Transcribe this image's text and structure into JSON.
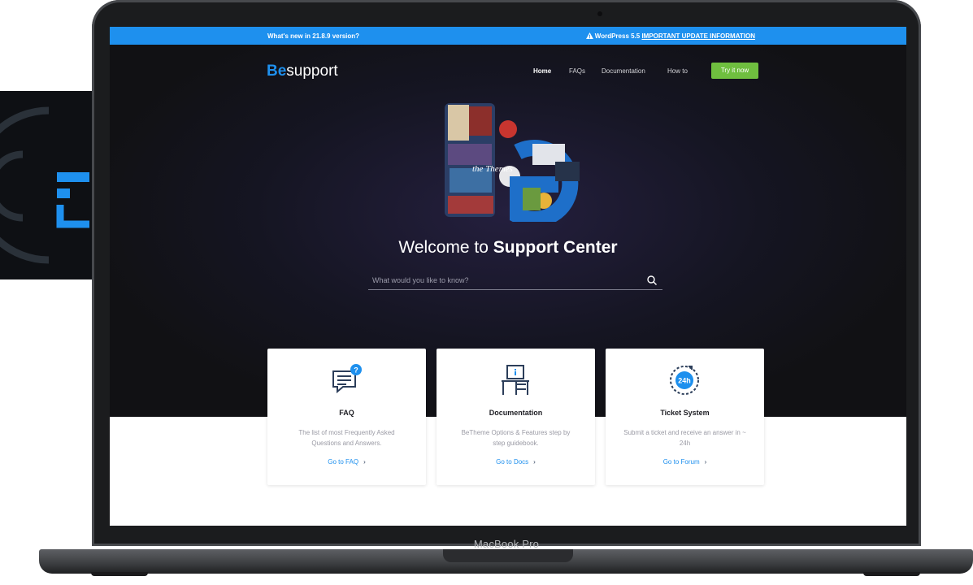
{
  "device": {
    "label": "MacBook Pro"
  },
  "announcement": {
    "left_prefix": "What's new in ",
    "version": "21.8.9",
    "left_suffix": " version?",
    "right_prefix": "WordPress 5.5 ",
    "right_link": "IMPORTANT UPDATE INFORMATION",
    "warning_icon": "warning-icon"
  },
  "header": {
    "logo_be": "Be",
    "logo_rest": "support",
    "nav": [
      "Home",
      "FAQs",
      "Documentation",
      "How to"
    ],
    "cta": "Try it now"
  },
  "hero": {
    "title_light": "Welcome to ",
    "title_bold": "Support Center",
    "search_placeholder": "What would you like to know?",
    "search_icon": "search-icon"
  },
  "cards": [
    {
      "icon": "faq-chat-icon",
      "title": "FAQ",
      "desc": "The list of most Frequently Asked Questions and Answers.",
      "link": "Go to FAQ"
    },
    {
      "icon": "documentation-desk-icon",
      "title": "Documentation",
      "desc": "BeTheme Options & Features step by step guidebook.",
      "link": "Go to Docs"
    },
    {
      "icon": "24h-support-icon",
      "title": "Ticket System",
      "desc": "Submit a ticket and receive an answer in ~ 24h",
      "link": "Go to Forum"
    }
  ],
  "colors": {
    "accent": "#1e90ee",
    "cta": "#6fbf3f",
    "hero_bg": "#111114"
  }
}
